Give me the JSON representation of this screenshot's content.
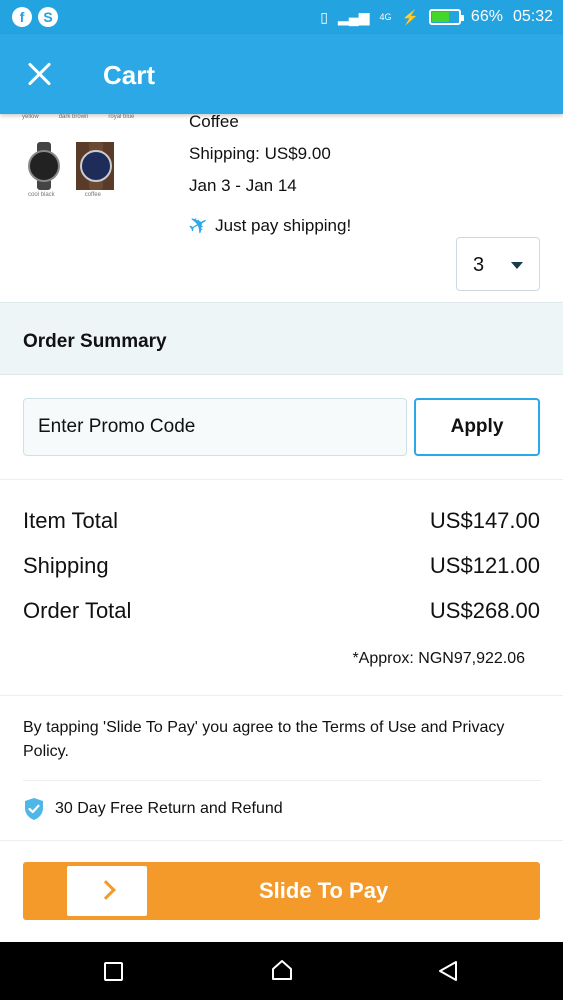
{
  "status_bar": {
    "network": "4G",
    "battery_percent": "66%",
    "battery_level": 0.66,
    "time": "05:32"
  },
  "app_bar": {
    "title": "Cart",
    "close_icon": "close-icon"
  },
  "product": {
    "thumb_labels_top": [
      "yellow",
      "dark brown",
      "royal blue"
    ],
    "thumb_captions": [
      "cool black",
      "coffee"
    ],
    "variant": "Coffee",
    "shipping": "Shipping: US$9.00",
    "delivery": "Jan 3 - Jan 14",
    "promo_note": "Just pay shipping!",
    "quantity": "3"
  },
  "order_summary": {
    "heading": "Order Summary",
    "promo_placeholder": "Enter Promo Code",
    "apply_label": "Apply",
    "rows": [
      {
        "label": "Item Total",
        "amount": "US$147.00"
      },
      {
        "label": "Shipping",
        "amount": "US$121.00"
      },
      {
        "label": "Order Total",
        "amount": "US$268.00"
      }
    ],
    "approx": "*Approx: NGN97,922.06"
  },
  "terms": "By tapping 'Slide To Pay' you agree to the Terms of Use and Privacy Policy.",
  "refund_note": "30 Day Free Return and Refund",
  "pay": {
    "label": "Slide To Pay"
  },
  "colors": {
    "accent": "#2ba8e5",
    "pay": "#f39a2b"
  }
}
